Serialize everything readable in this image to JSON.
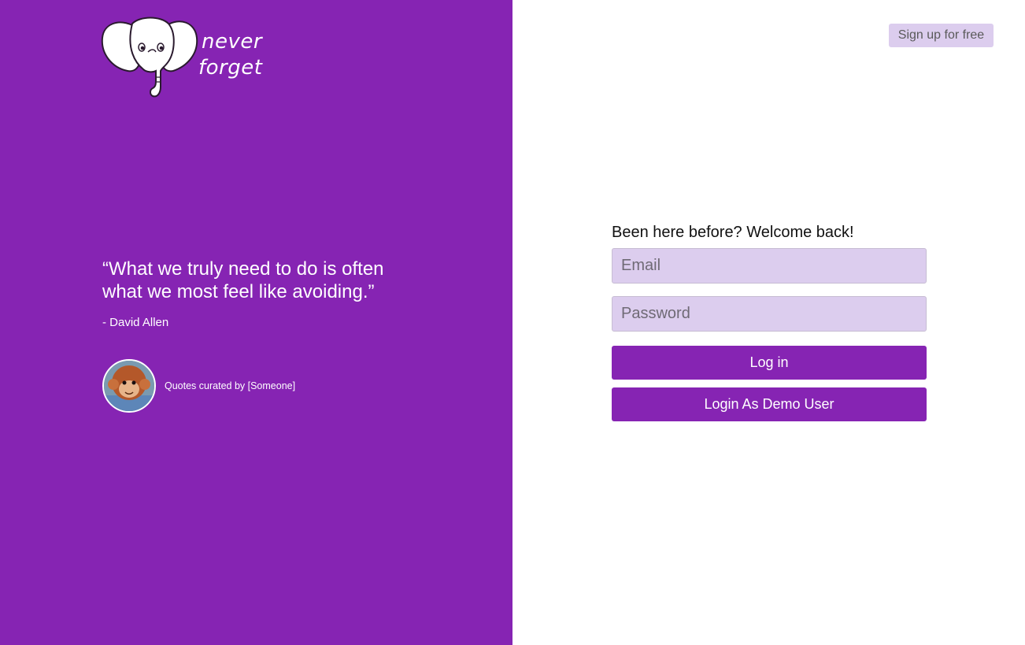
{
  "brand": {
    "logo_line1": "never",
    "logo_line2": "forget",
    "primary_color": "#8624b3",
    "light_accent": "#dccdee",
    "logo_icon": "elephant-icon"
  },
  "header": {
    "signup_label": "Sign up for free"
  },
  "quote": {
    "text": "“What we truly need to do is often what we most feel like avoiding.”",
    "author": "- David Allen",
    "curator": "Quotes curated by [Someone]",
    "avatar_icon": "monkey-avatar"
  },
  "login": {
    "welcome": "Been here before? Welcome back!",
    "email_placeholder": "Email",
    "email_value": "",
    "password_placeholder": "Password",
    "password_value": "",
    "login_label": "Log in",
    "demo_label": "Login As Demo User"
  }
}
